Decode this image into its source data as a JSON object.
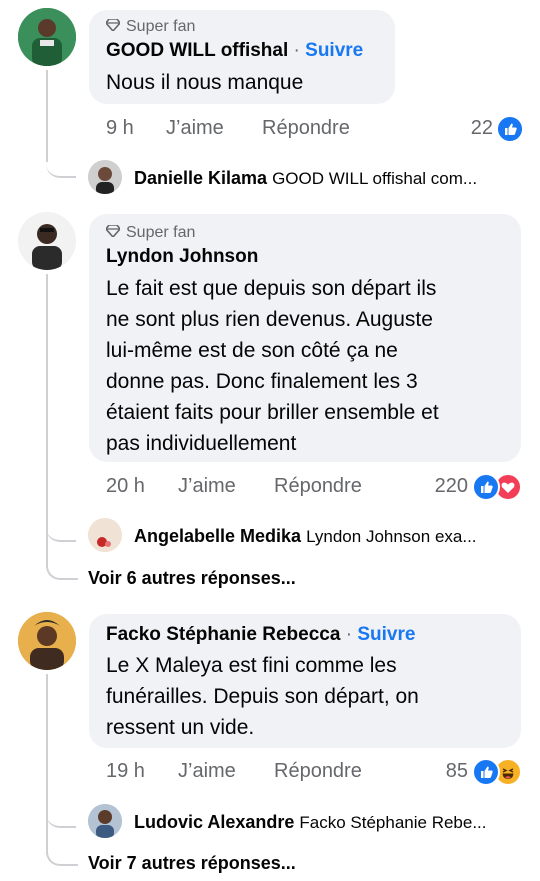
{
  "comments": [
    {
      "badge": "Super fan",
      "author": "GOOD WILL offishal",
      "separator": "·",
      "follow": "Suivre",
      "text": "Nous il nous manque",
      "time": "9 h",
      "like": "J’aime",
      "reply": "Répondre",
      "reaction_count": "22",
      "reactions": [
        "like-icon"
      ],
      "replies": [
        {
          "author": "Danielle Kilama",
          "text": "GOOD WILL offishal com..."
        }
      ]
    },
    {
      "badge": "Super fan",
      "author": "Lyndon Johnson",
      "text_lines": [
        "Le fait est que depuis son départ ils",
        "ne sont plus rien devenus. Auguste",
        "lui-même est de son côté ça ne",
        "donne pas. Donc finalement les 3",
        "étaient faits pour briller ensemble et",
        "pas individuellement"
      ],
      "time": "20 h",
      "like": "J’aime",
      "reply": "Répondre",
      "reaction_count": "220",
      "reactions": [
        "like-icon",
        "love-icon"
      ],
      "replies": [
        {
          "author": "Angelabelle Medika",
          "text": "Lyndon Johnson exa..."
        }
      ],
      "more_replies": "Voir 6 autres réponses..."
    },
    {
      "author": "Facko Stéphanie Rebecca",
      "separator": "·",
      "follow": "Suivre",
      "text_lines": [
        "Le X Maleya est fini comme les",
        "funérailles. Depuis son départ, on",
        "ressent un vide."
      ],
      "time": "19 h",
      "like": "J’aime",
      "reply": "Répondre",
      "reaction_count": "85",
      "reactions": [
        "like-icon",
        "haha-icon"
      ],
      "replies": [
        {
          "author": "Ludovic Alexandre",
          "text": "Facko Stéphanie Rebe..."
        }
      ],
      "more_replies": "Voir 7 autres réponses..."
    }
  ],
  "colors": {
    "bubble": "#f0f2f5",
    "link": "#1877f2",
    "meta": "#65676b",
    "thread_line": "#ced0d4",
    "like": "#1877f2",
    "love": "#f33e58",
    "haha": "#f7b125"
  }
}
